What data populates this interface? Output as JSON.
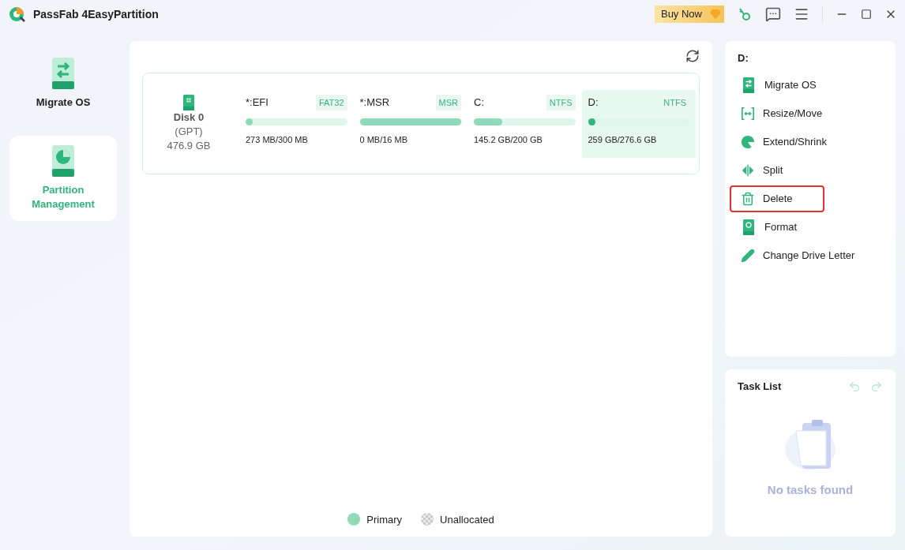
{
  "window": {
    "title": "PassFab 4EasyPartition",
    "buy_button": "Buy Now"
  },
  "nav": [
    {
      "label": "Migrate OS",
      "kind": "migrate",
      "selected": false
    },
    {
      "label": "Partition Management",
      "kind": "partition",
      "selected": true
    }
  ],
  "disk": {
    "name": "Disk 0",
    "scheme": "(GPT)",
    "size": "476.9 GB"
  },
  "partitions": [
    {
      "name": "*:EFI",
      "fs": "FAT32",
      "usage": "273 MB/300 MB",
      "level": 0.05,
      "selected": false
    },
    {
      "name": "*:MSR",
      "fs": "MSR",
      "usage": "0 MB/16 MB",
      "level": 1,
      "selected": false
    },
    {
      "name": "C:",
      "fs": "NTFS",
      "usage": "145.2 GB/200 GB",
      "level": 0.28,
      "selected": false
    },
    {
      "name": "D:",
      "fs": "NTFS",
      "usage": "259 GB/276.6 GB",
      "level": 0.05,
      "selected": true
    }
  ],
  "legend": [
    {
      "label": "Primary",
      "kind": "primary"
    },
    {
      "label": "Unallocated",
      "kind": "unallocated"
    }
  ],
  "actions": {
    "title": "D:",
    "items": [
      {
        "label": "Migrate OS",
        "kind": "migrate",
        "highlighted": false
      },
      {
        "label": "Resize/Move",
        "kind": "resize",
        "highlighted": false
      },
      {
        "label": "Extend/Shrink",
        "kind": "extend",
        "highlighted": false
      },
      {
        "label": "Split",
        "kind": "split",
        "highlighted": false
      },
      {
        "label": "Delete",
        "kind": "delete",
        "highlighted": true
      },
      {
        "label": "Format",
        "kind": "format",
        "highlighted": false
      },
      {
        "label": "Change Drive Letter",
        "kind": "letter",
        "highlighted": false
      }
    ]
  },
  "task_list": {
    "title": "Task List",
    "empty_text": "No tasks found"
  }
}
